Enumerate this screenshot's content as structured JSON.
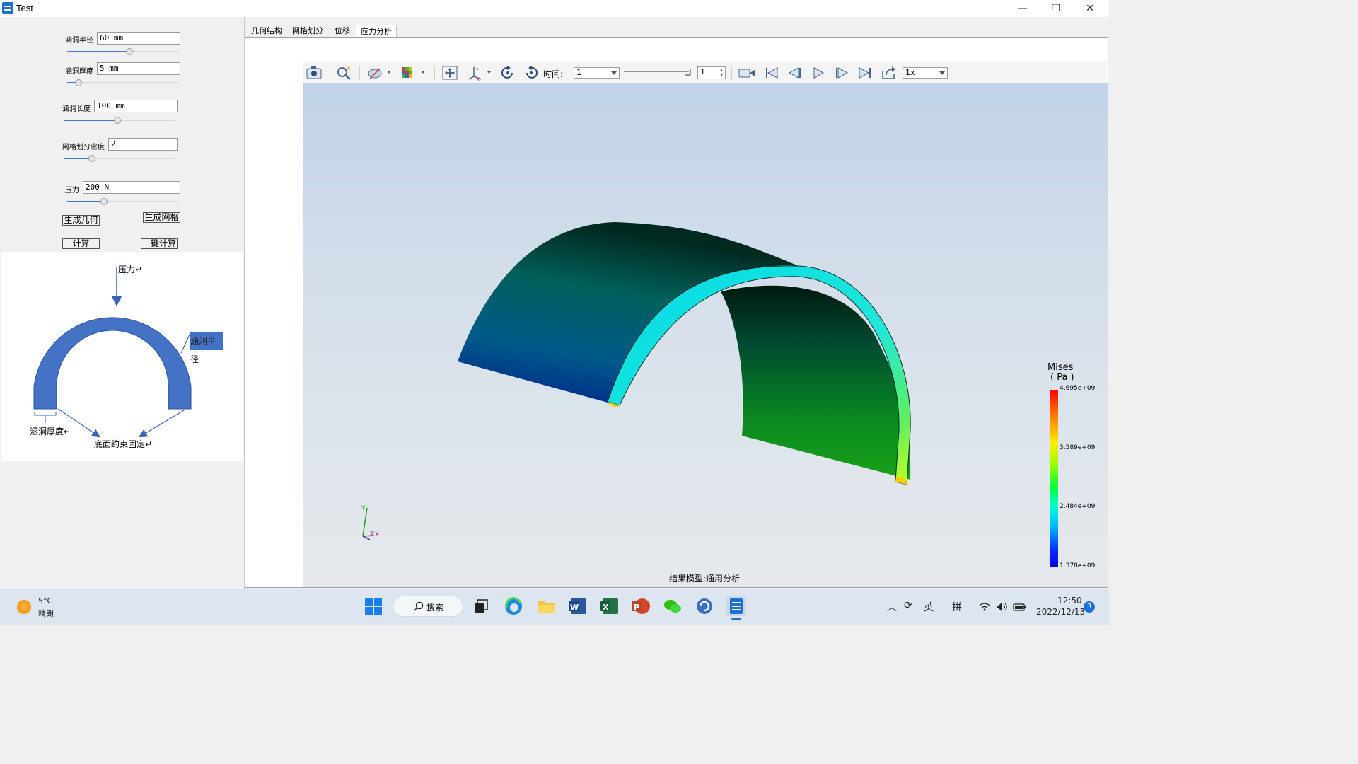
{
  "window": {
    "title": "Test",
    "minimize": "—",
    "maximize": "❐",
    "close": "✕"
  },
  "params": [
    {
      "label": "涵洞半径",
      "value": "60 mm",
      "slider": 0.56
    },
    {
      "label": "涵洞厚度",
      "value": "5 mm",
      "slider": 0.1
    },
    {
      "label": "涵洞长度",
      "value": "100 mm",
      "slider": 0.48
    },
    {
      "label": "网格划分密度",
      "value": "2",
      "slider": 0.25
    },
    {
      "label": "压力",
      "value": "200 N",
      "slider": 0.33
    }
  ],
  "buttons": {
    "gen_geom": "生成几何",
    "gen_mesh": "生成网格",
    "compute": "计算",
    "one_click": "一键计算"
  },
  "diagram": {
    "pressure": "压力↵",
    "radius": "涵洞半径",
    "thickness": "涵洞厚度↵",
    "fixed": "底面约束固定↵"
  },
  "tabs": [
    "几何结构",
    "网格划分",
    "位移",
    "应力分析"
  ],
  "toolbar": {
    "time_label": "时间:",
    "time_value": "1",
    "step_value": "1",
    "speed": "1x"
  },
  "legend": {
    "title": "Mises",
    "unit": "( Pa )",
    "values": [
      "4.695e+09",
      "3.589e+09",
      "2.484e+09",
      "1.378e+09"
    ]
  },
  "axes": {
    "y": "Y",
    "z": "Z",
    "x": "X"
  },
  "model_label": "结果模型:通用分析",
  "taskbar": {
    "temp": "5°C",
    "weather": "晴朗",
    "search": "搜索",
    "ime1": "英",
    "ime2": "拼",
    "time": "12:50",
    "date": "2022/12/13",
    "notif": "3"
  }
}
